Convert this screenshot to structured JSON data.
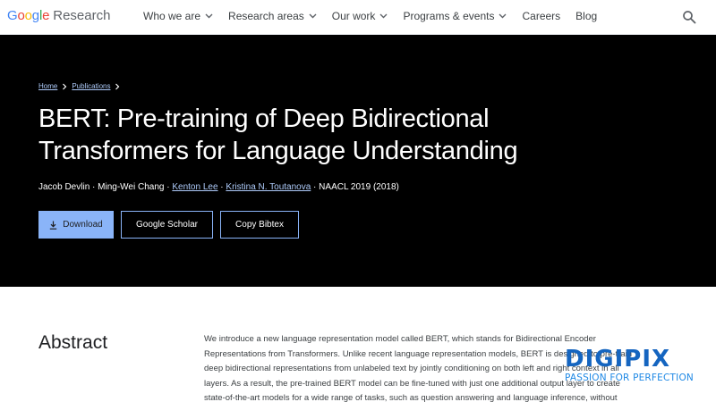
{
  "nav": {
    "logo_google": "Google",
    "logo_research": "Research",
    "items": [
      {
        "label": "Who we are",
        "has_menu": true
      },
      {
        "label": "Research areas",
        "has_menu": true
      },
      {
        "label": "Our work",
        "has_menu": true
      },
      {
        "label": "Programs & events",
        "has_menu": true
      },
      {
        "label": "Careers",
        "has_menu": false
      },
      {
        "label": "Blog",
        "has_menu": false
      }
    ],
    "search_icon": "search-icon"
  },
  "breadcrumb": {
    "home": "Home",
    "publications": "Publications"
  },
  "paper": {
    "title_line1": "BERT: Pre-training of Deep Bidirectional",
    "title_line2": "Transformers for Language Understanding",
    "authors": [
      {
        "name": "Jacob Devlin",
        "linked": false
      },
      {
        "name": "Ming-Wei Chang",
        "linked": false
      },
      {
        "name": "Kenton Lee",
        "linked": true
      },
      {
        "name": "Kristina N. Toutanova",
        "linked": true
      }
    ],
    "venue": "NAACL 2019 (2018)"
  },
  "actions": {
    "download": "Download",
    "scholar": "Google Scholar",
    "bibtex": "Copy Bibtex"
  },
  "abstract": {
    "heading": "Abstract",
    "lines": [
      "We introduce a new language representation model called BERT, which stands for Bidirectional Encoder",
      "Representations from Transformers. Unlike recent language representation models, BERT is designed to pre-train",
      "deep bidirectional representations from unlabeled text by jointly conditioning on both left and right context in all",
      "layers. As a result, the pre-trained BERT model can be fine-tuned with just one additional output layer to create",
      "state-of-the-art models for a wide range of tasks, such as question answering and language inference, without"
    ]
  },
  "watermark": {
    "brand_part1": "DIGI",
    "brand_part2": "PIX",
    "tagline": "PASSION FOR PERFECTION"
  },
  "colors": {
    "hero_bg": "#000000",
    "accent": "#8ab4f8",
    "link": "#aecbfa",
    "watermark_blue": "#1565c0"
  }
}
